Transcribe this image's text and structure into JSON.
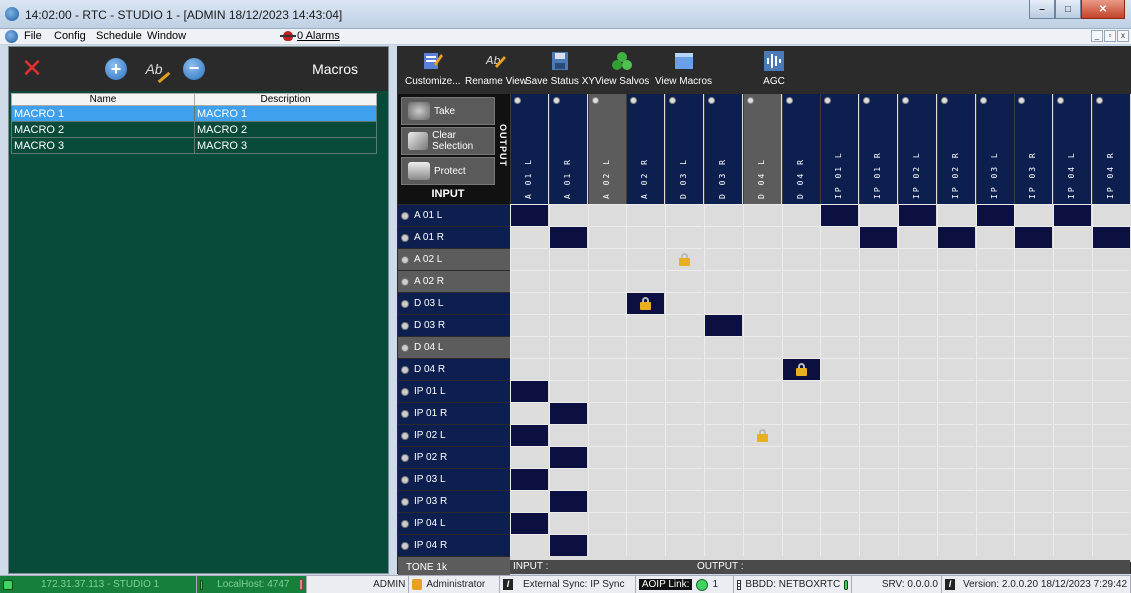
{
  "window": {
    "title": "14:02:00   - RTC  -  STUDIO 1 - [ADMIN  18/12/2023 14:43:04]",
    "controls": [
      "–",
      "□",
      "✕"
    ]
  },
  "menu": {
    "items": [
      "File",
      "Config",
      "Schedule",
      "Window"
    ],
    "alarms": "0 Alarms"
  },
  "macros_panel": {
    "title": "Macros",
    "columns": [
      "Name",
      "Description"
    ],
    "rows": [
      {
        "name": "MACRO 1",
        "description": "MACRO 1",
        "selected": true
      },
      {
        "name": "MACRO 2",
        "description": "MACRO 2",
        "selected": false
      },
      {
        "name": "MACRO 3",
        "description": "MACRO 3",
        "selected": false
      }
    ]
  },
  "toolbar": {
    "customize": "Customize...",
    "rename_view": "Rename View",
    "save_status_xy": "Save Status XY",
    "view_salvos": "View Salvos",
    "view_macros": "View Macros",
    "agc": "AGC"
  },
  "matrix": {
    "take": "Take",
    "clear_selection": "Clear Selection",
    "protect": "Protect",
    "output_label": "OUTPUT",
    "input_label": "INPUT",
    "outputs": [
      {
        "label": "A 01 L",
        "style": "dark"
      },
      {
        "label": "A 01 R",
        "style": "dark"
      },
      {
        "label": "A 02 L",
        "style": "grey"
      },
      {
        "label": "A 02 R",
        "style": "dark"
      },
      {
        "label": "D 03 L",
        "style": "dark"
      },
      {
        "label": "D 03 R",
        "style": "dark"
      },
      {
        "label": "D 04 L",
        "style": "grey"
      },
      {
        "label": "D 04 R",
        "style": "dark"
      },
      {
        "label": "IP 01 L",
        "style": "dark"
      },
      {
        "label": "IP 01 R",
        "style": "dark"
      },
      {
        "label": "IP 02 L",
        "style": "dark"
      },
      {
        "label": "IP 02 R",
        "style": "dark"
      },
      {
        "label": "IP 03 L",
        "style": "dark"
      },
      {
        "label": "IP 03 R",
        "style": "dark"
      },
      {
        "label": "IP 04 L",
        "style": "dark"
      },
      {
        "label": "IP 04 R",
        "style": "dark"
      }
    ],
    "inputs": [
      {
        "label": "A 01 L",
        "style": "dark"
      },
      {
        "label": "A 01 R",
        "style": "dark"
      },
      {
        "label": "A 02 L",
        "style": "grey"
      },
      {
        "label": "A 02 R",
        "style": "grey"
      },
      {
        "label": "D 03 L",
        "style": "dark"
      },
      {
        "label": "D 03 R",
        "style": "dark"
      },
      {
        "label": "D 04 L",
        "style": "grey"
      },
      {
        "label": "D 04 R",
        "style": "dark"
      },
      {
        "label": "IP 01 L",
        "style": "dark"
      },
      {
        "label": "IP 01 R",
        "style": "dark"
      },
      {
        "label": "IP 02 L",
        "style": "dark"
      },
      {
        "label": "IP 02 R",
        "style": "dark"
      },
      {
        "label": "IP 03 L",
        "style": "dark"
      },
      {
        "label": "IP 03 R",
        "style": "dark"
      },
      {
        "label": "IP 04 L",
        "style": "dark"
      },
      {
        "label": "IP 04 R",
        "style": "dark"
      },
      {
        "label": "TONE 1k",
        "style": "grey",
        "no_led": true
      }
    ],
    "connections": [
      [
        0,
        0
      ],
      [
        0,
        8
      ],
      [
        0,
        10
      ],
      [
        0,
        12
      ],
      [
        0,
        14
      ],
      [
        1,
        1
      ],
      [
        1,
        9
      ],
      [
        1,
        11
      ],
      [
        1,
        13
      ],
      [
        1,
        15
      ],
      [
        4,
        3
      ],
      [
        5,
        5
      ],
      [
        7,
        7
      ],
      [
        8,
        0
      ],
      [
        9,
        1
      ],
      [
        10,
        0
      ],
      [
        11,
        1
      ],
      [
        12,
        0
      ],
      [
        13,
        1
      ],
      [
        14,
        0
      ],
      [
        15,
        1
      ]
    ],
    "locks": [
      [
        2,
        4
      ],
      [
        4,
        3
      ],
      [
        7,
        7
      ],
      [
        10,
        6
      ]
    ],
    "input_status": "INPUT :",
    "output_status": "OUTPUT :"
  },
  "statusbar": {
    "ip": "172.31.37.113 - STUDIO 1",
    "localhost": "LocalHost: 4747",
    "user": "ADMIN",
    "role": "Administrator",
    "sync": "External Sync: IP Sync",
    "aoip_link": "AOIP Link:",
    "aoip_count": "1",
    "bbdd": "BBDD: NETBOXRTC",
    "srv": "SRV: 0.0.0.0",
    "version": "Version: 2.0.0.20  18/12/2023 7:29:42"
  }
}
